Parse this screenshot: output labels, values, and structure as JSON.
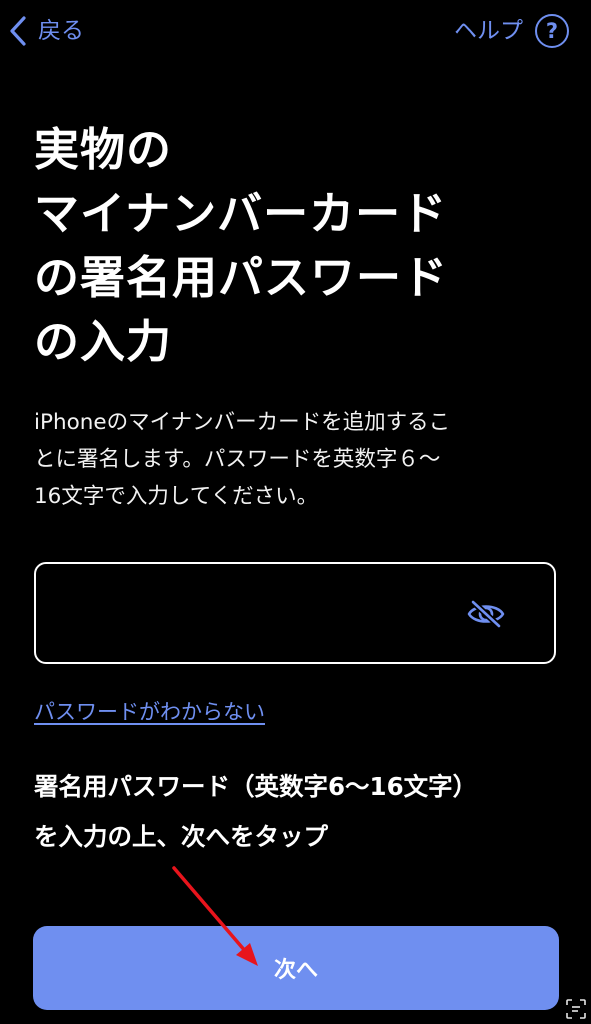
{
  "nav": {
    "back_label": "戻る",
    "help_label": "ヘルプ",
    "help_icon_glyph": "?"
  },
  "title": {
    "lines": [
      "実物の",
      "マイナンバーカード",
      "の署名用パスワード",
      "の入力"
    ]
  },
  "description": {
    "lines": [
      "iPhoneのマイナンバーカードを追加するこ",
      "とに署名します。パスワードを英数字６～",
      "16文字で入力してください。"
    ]
  },
  "password": {
    "value": "",
    "placeholder": ""
  },
  "forgot_link": "パスワードがわからない",
  "instruction": {
    "lines": [
      "署名用パスワード（英数字6～16文字）",
      "を入力の上、次へをタップ"
    ]
  },
  "next_button": "次へ",
  "icons": {
    "back": "chevron-left-icon",
    "help": "question-circle-icon",
    "visibility": "eye-slash-icon",
    "annotation": "red-arrow-icon",
    "corner": "scan-text-icon"
  },
  "colors": {
    "background": "#000000",
    "accent": "#6f8ff0",
    "text": "#ffffff",
    "annotation_arrow": "#e8141c"
  }
}
